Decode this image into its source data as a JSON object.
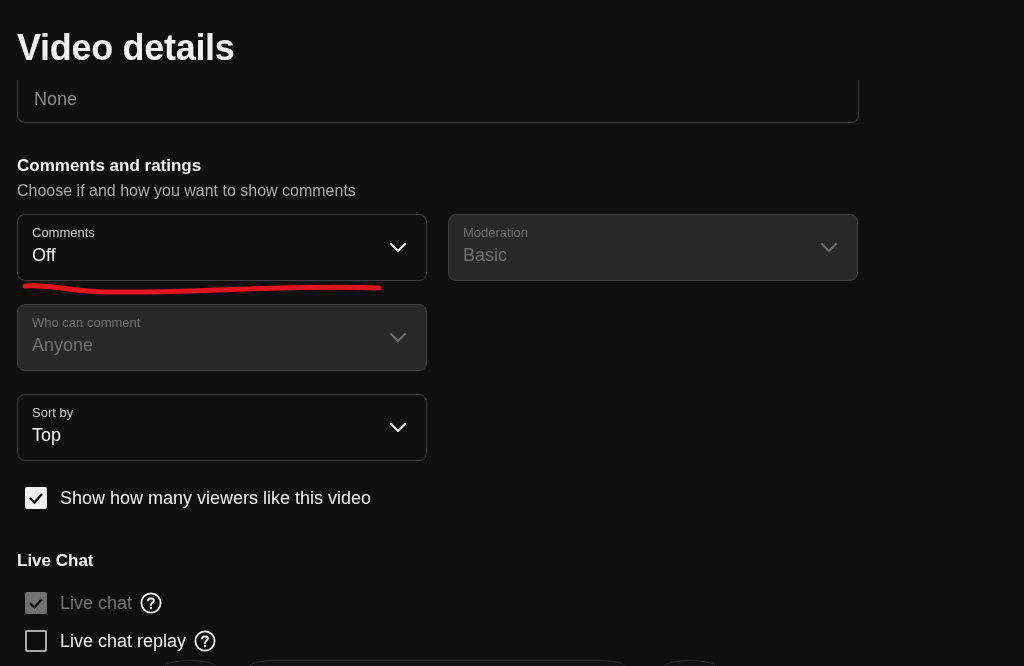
{
  "page": {
    "title": "Video details"
  },
  "field_above": {
    "value": "None"
  },
  "comments_section": {
    "heading": "Comments and ratings",
    "description": "Choose if and how you want to show comments",
    "dropdown_rows": [
      [
        {
          "label": "Comments",
          "value": "Off",
          "disabled": false,
          "underlined": true
        },
        {
          "label": "Moderation",
          "value": "Basic",
          "disabled": true,
          "underlined": false
        }
      ],
      [
        {
          "label": "Who can comment",
          "value": "Anyone",
          "disabled": true,
          "underlined": false
        }
      ],
      [
        {
          "label": "Sort by",
          "value": "Top",
          "disabled": false,
          "underlined": false
        }
      ]
    ],
    "checkboxes": [
      {
        "label": "Show how many viewers like this video",
        "checked": true,
        "disabled": false,
        "help": false
      }
    ]
  },
  "live_chat": {
    "heading": "Live Chat",
    "checkboxes": [
      {
        "label": "Live chat",
        "checked": true,
        "disabled": true,
        "help": true
      },
      {
        "label": "Live chat replay",
        "checked": false,
        "disabled": false,
        "help": true
      }
    ]
  }
}
